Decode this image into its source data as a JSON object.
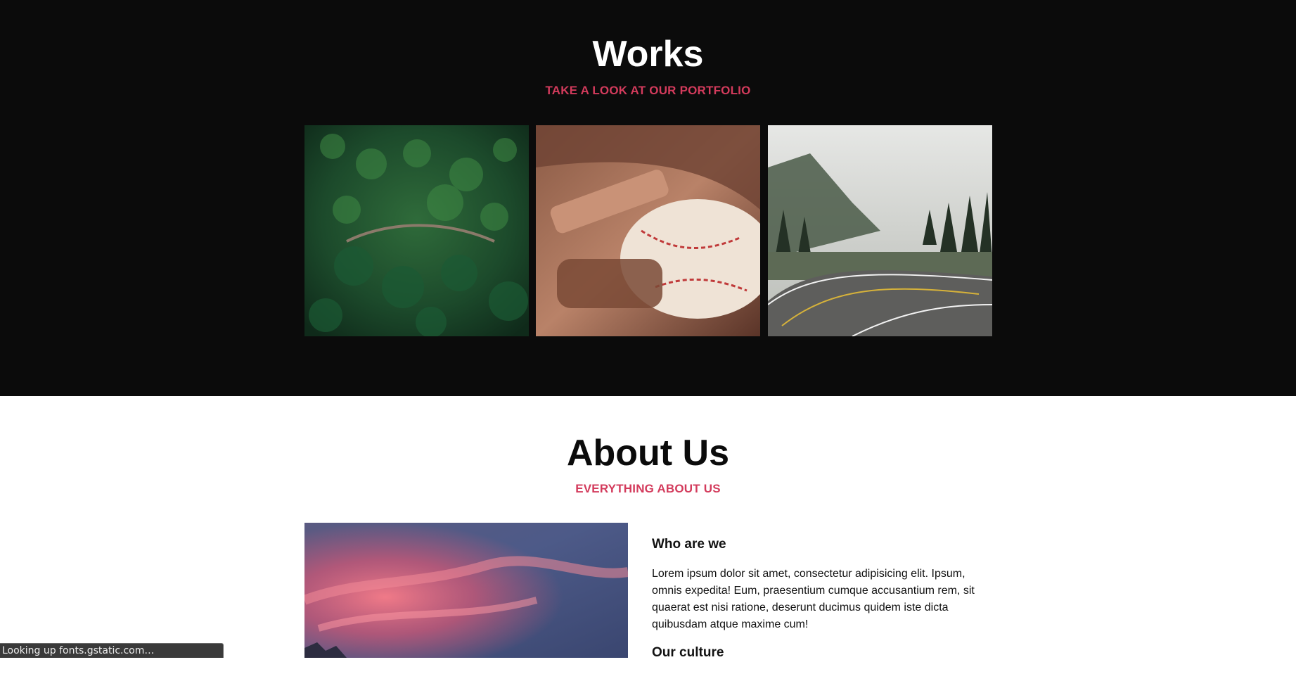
{
  "works": {
    "title": "Works",
    "subtitle": "TAKE A LOOK AT OUR PORTFOLIO"
  },
  "about": {
    "title": "About Us",
    "subtitle": "EVERYTHING ABOUT US",
    "who_heading": "Who are we",
    "who_text": "Lorem ipsum dolor sit amet, consectetur adipisicing elit. Ipsum, omnis expedita! Eum, praesentium cumque accusantium rem, sit quaerat est nisi ratione, deserunt ducimus quidem iste dicta quibusdam atque maxime cum!",
    "culture_heading": "Our culture"
  },
  "status": {
    "text": "Looking up fonts.gstatic.com…"
  },
  "colors": {
    "accent": "#d33b5c",
    "dark_bg": "#0b0b0b",
    "light_bg": "#ffffff"
  }
}
